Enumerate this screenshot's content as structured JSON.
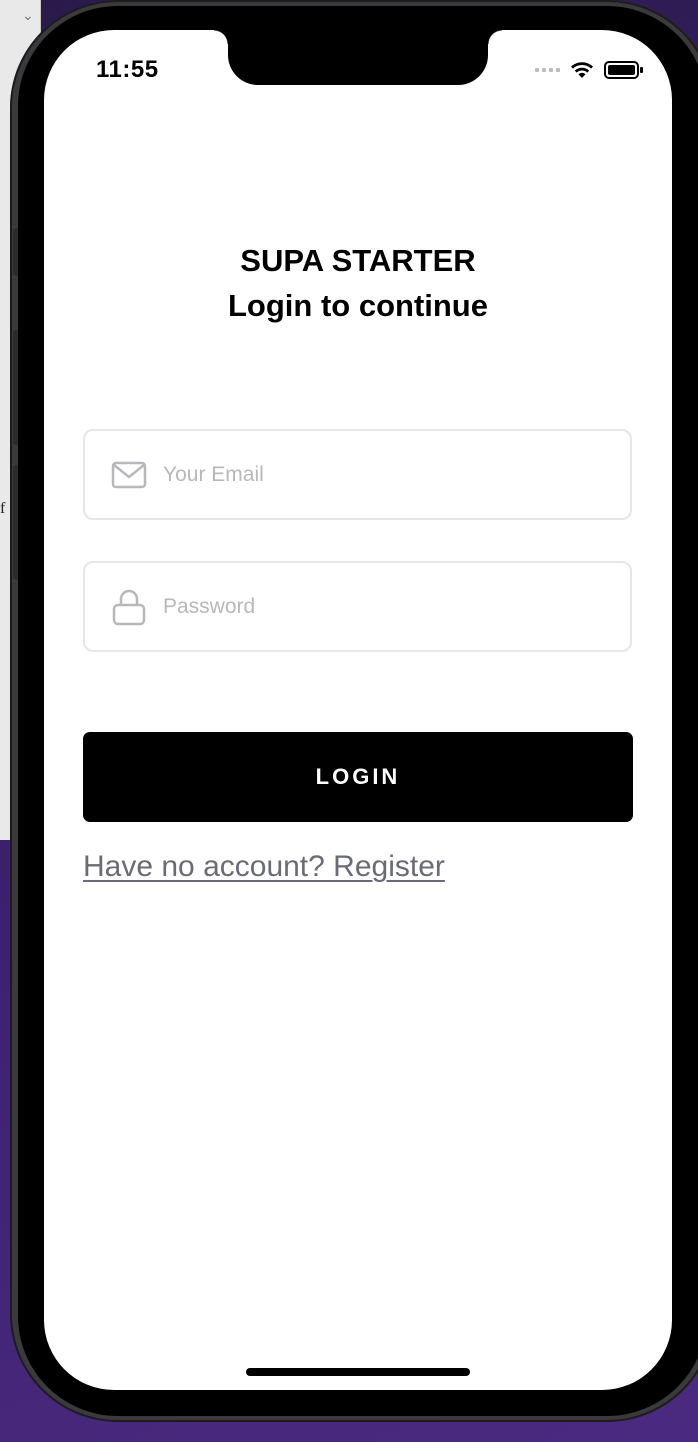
{
  "status_bar": {
    "time": "11:55"
  },
  "header": {
    "app_title": "SUPA STARTER",
    "subtitle": "Login to continue"
  },
  "form": {
    "email": {
      "placeholder": "Your Email",
      "value": "",
      "icon": "mail-icon"
    },
    "password": {
      "placeholder": "Password",
      "value": "",
      "icon": "lock-icon"
    },
    "login_label": "LOGIN",
    "register_link": "Have no account? Register"
  },
  "colors": {
    "button_bg": "#000000",
    "button_text": "#ffffff",
    "link": "#6b6b78",
    "placeholder": "#b8b8bc",
    "background": "#ffffff"
  }
}
